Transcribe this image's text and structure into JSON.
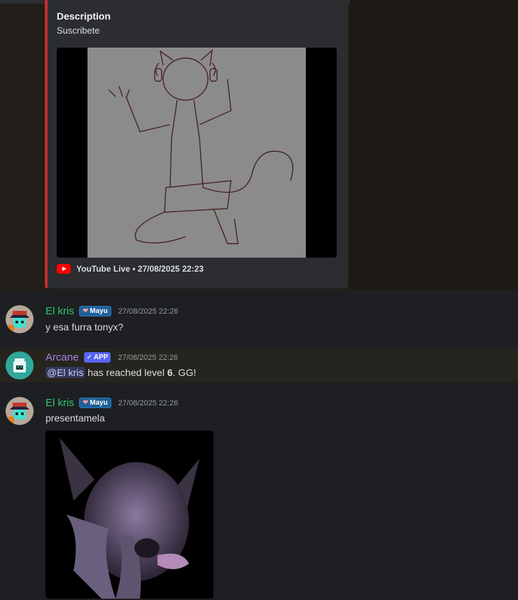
{
  "embed": {
    "description_title": "Description",
    "description_text": "Suscribete",
    "footer_provider": "YouTube Live",
    "footer_separator": "•",
    "footer_time": "27/08/2025 22:23"
  },
  "messages": [
    {
      "username": "El kris",
      "tag": "Mayu",
      "tag_icon": "heart-icon",
      "timestamp": "27/08/2025 22:26",
      "text": "y esa furra tonyx?"
    },
    {
      "username": "Arcane",
      "tag": "APP",
      "tag_icon": "checkmark-icon",
      "timestamp": "27/08/2025 22:26",
      "mention": "@El kris",
      "text_before_level": "has reached level",
      "level": "6",
      "text_after_level": ". GG!"
    },
    {
      "username": "El kris",
      "tag": "Mayu",
      "tag_icon": "heart-icon",
      "timestamp": "27/08/2025 22:26",
      "text": "presentamela"
    }
  ],
  "colors": {
    "background": "#1e1f22",
    "embed_accent": "#c4302b",
    "username_green": "#2dc770",
    "username_purple": "#a782e6",
    "app_tag": "#5865f2"
  }
}
